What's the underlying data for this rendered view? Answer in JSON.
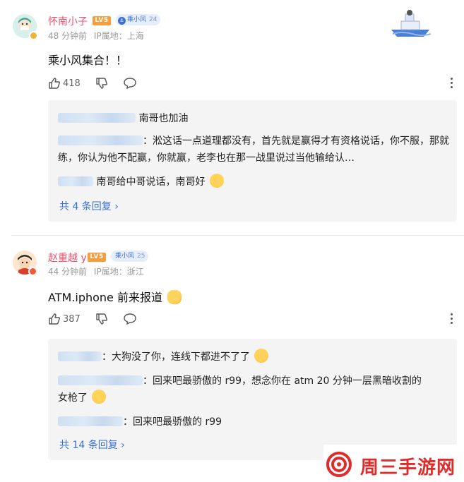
{
  "colors": {
    "username": "#e8536f",
    "link": "#3a6fd8",
    "level_badge": "#f79d3b",
    "fan_badge_bg": "#e6eefc",
    "reply_bg": "#f4f4f4",
    "watermark": "#e02b2b"
  },
  "comments": [
    {
      "username": "怀南小子",
      "level": "LV5",
      "fan_badge": {
        "icon": "anchor-icon",
        "label": "乘小风",
        "level": "24"
      },
      "time": "48 分钟前",
      "ip": "IP属地：上海",
      "content": "乘小风集合！！",
      "like_count": "418",
      "replies": [
        {
          "text": "南哥也加油"
        },
        {
          "text": "：淞这话一点道理都没有，首先就是赢得才有资格说话，你不服，那就练，你认为他不配赢，你就赢，老李也在那一战里说过当他输给认…"
        },
        {
          "text": "南哥给中哥说话，南哥好"
        }
      ],
      "view_more": "共 4 条回复 ›"
    },
    {
      "username": "赵重越 y",
      "level": "LV5",
      "fan_badge": {
        "icon": "",
        "label": "乘小风",
        "level": "25"
      },
      "time": "44 分钟前",
      "ip": "IP属地：浙江",
      "content": "ATM.iphone 前来报道",
      "like_count": "387",
      "replies": [
        {
          "text": "：大狗没了你，连线下都进不了了"
        },
        {
          "text_line1": "：回来吧最骄傲的 r99，想念你在 atm 20 分钟一层黑暗收割的",
          "text_line2": "女枪了"
        },
        {
          "text": "：回来吧最骄傲的 r99"
        }
      ],
      "view_more": "共 14 条回复 ›"
    }
  ],
  "watermark": {
    "text": "周三手游网"
  }
}
